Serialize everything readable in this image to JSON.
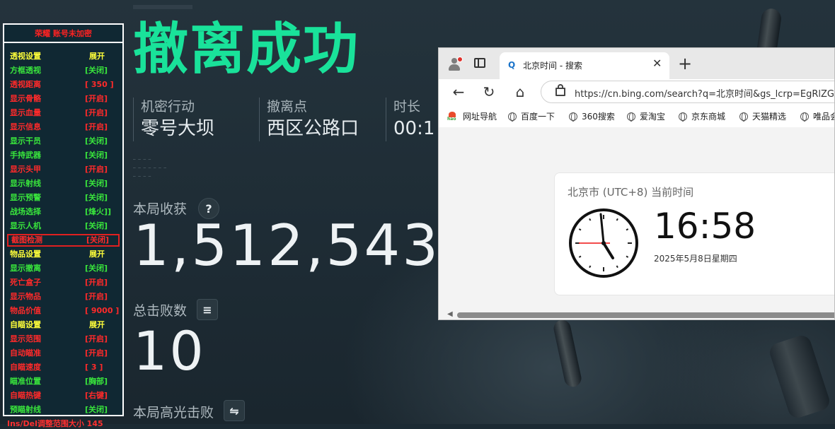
{
  "game": {
    "title": "撤离成功",
    "info": [
      {
        "label": "机密行动",
        "value": "零号大坝"
      },
      {
        "label": "撤离点",
        "value": "西区公路口"
      },
      {
        "label": "时长",
        "value": "00:1"
      }
    ],
    "stats": {
      "loot_label": "本局收获",
      "loot_value": "1,512,543",
      "kills_label": "总击败数",
      "kills_value": "10",
      "highlight_label": "本局高光击败"
    }
  },
  "cheat_menu": {
    "header": "荣耀  账号未加密",
    "items": [
      {
        "name": "透视设置",
        "value": "展开",
        "section": true,
        "color": "yellow"
      },
      {
        "name": "方框透视",
        "value": "[关闭]",
        "color": "green"
      },
      {
        "name": "透视距离",
        "value": "[  350 ]",
        "color": "red"
      },
      {
        "name": "显示骨骼",
        "value": "[开启]",
        "color": "red"
      },
      {
        "name": "显示血量",
        "value": "[开启]",
        "color": "red"
      },
      {
        "name": "显示信息",
        "value": "[开启]",
        "color": "red"
      },
      {
        "name": "显示干员",
        "value": "[关闭]",
        "color": "green"
      },
      {
        "name": "手持武器",
        "value": "[关闭]",
        "color": "green"
      },
      {
        "name": "显示头甲",
        "value": "[开启]",
        "color": "red"
      },
      {
        "name": "显示射线",
        "value": "[关闭]",
        "color": "green"
      },
      {
        "name": "显示预警",
        "value": "[关闭]",
        "color": "green"
      },
      {
        "name": "战场选择",
        "value": "[烽火]]",
        "color": "green"
      },
      {
        "name": "显示人机",
        "value": "[关闭]",
        "color": "green"
      },
      {
        "name": "截图检测",
        "value": "[关闭]",
        "color": "red",
        "selected": true
      },
      {
        "name": "物品设置",
        "value": "展开",
        "section": true,
        "color": "yellow"
      },
      {
        "name": "显示撤离",
        "value": "[关闭]",
        "color": "green"
      },
      {
        "name": "死亡盒子",
        "value": "[开启]",
        "color": "red"
      },
      {
        "name": "显示物品",
        "value": "[开启]",
        "color": "red"
      },
      {
        "name": "物品价值",
        "value": "[  9000 ]",
        "color": "red"
      },
      {
        "name": "自瞄设置",
        "value": "展开",
        "section": true,
        "color": "yellow"
      },
      {
        "name": "显示范围",
        "value": "[开启]",
        "color": "red"
      },
      {
        "name": "自动瞄准",
        "value": "[开启]",
        "color": "red"
      },
      {
        "name": "自瞄速度",
        "value": "[  3 ]",
        "color": "red"
      },
      {
        "name": "瞄准位置",
        "value": "[胸部]",
        "color": "green"
      },
      {
        "name": "自瞄热键",
        "value": "[右键]",
        "color": "red"
      },
      {
        "name": "预瞄射线",
        "value": "[关闭]",
        "color": "green"
      }
    ],
    "footer": "Ins/Del调整范围大小 145"
  },
  "browser": {
    "tab_title": "北京时间 - 搜索",
    "url": "https://cn.bing.com/search?q=北京时间&gs_lcrp=EgRlZGdlK",
    "favorites": [
      "网址导航",
      "百度一下",
      "360搜索",
      "爱淘宝",
      "京东商城",
      "天猫精选",
      "唯品会"
    ],
    "result_card": {
      "title": "北京市 (UTC+8) 当前时间",
      "time": "16:58",
      "date": "2025年5月8日星期四"
    }
  }
}
